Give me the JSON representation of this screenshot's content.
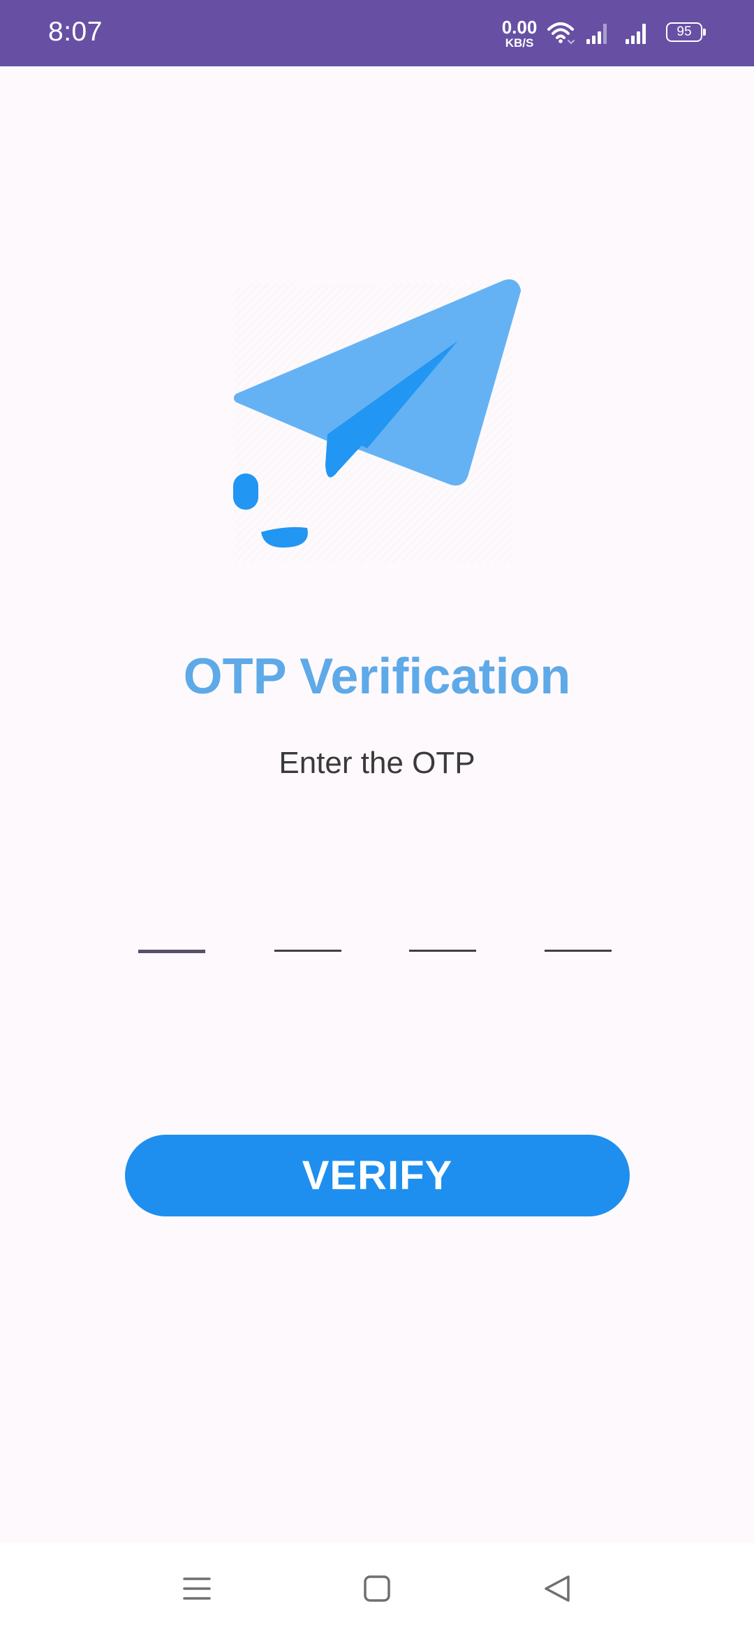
{
  "status_bar": {
    "time": "8:07",
    "net_speed_value": "0.00",
    "net_speed_unit": "KB/S",
    "battery": "95",
    "background_color": "#6750A4"
  },
  "illustration": {
    "icon": "paper-plane-icon",
    "colors": {
      "light": "#64B2F4",
      "dark": "#2196F3"
    }
  },
  "title": "OTP Verification",
  "subtitle": "Enter the OTP",
  "otp": {
    "digits": [
      "",
      "",
      "",
      ""
    ]
  },
  "verify_button_label": "VERIFY",
  "colors": {
    "title": "#5EA9E8",
    "button": "#1E8FEF",
    "background": "#FEF9FC"
  },
  "nav_bar": {
    "items": [
      "recent-apps-icon",
      "home-icon",
      "back-icon"
    ]
  }
}
